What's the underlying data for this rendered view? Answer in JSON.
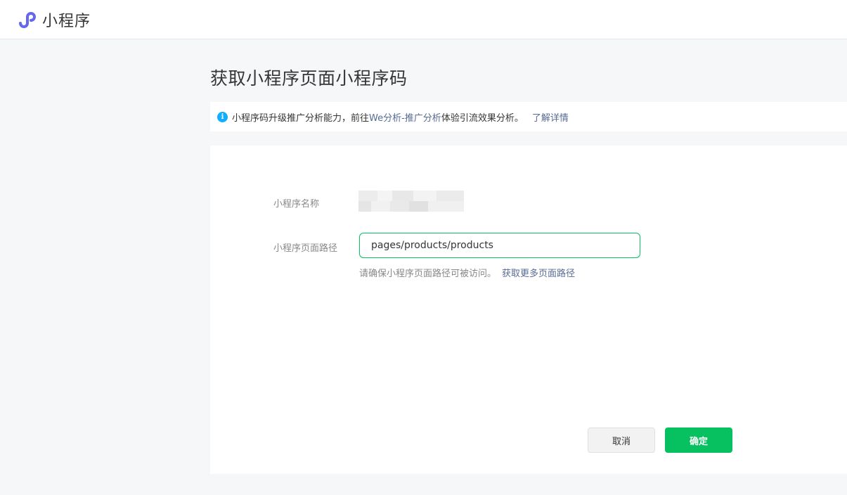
{
  "app": {
    "title": "小程序",
    "logo_icon": "miniprogram-logo-icon",
    "brand_color": "#6467f0"
  },
  "page": {
    "title": "获取小程序页面小程序码"
  },
  "notice": {
    "icon": "info-icon",
    "text_before": "小程序码升级推广分析能力，前往",
    "link_text": "We分析-推广分析",
    "text_after": "体验引流效果分析。",
    "more_link": "了解详情"
  },
  "form": {
    "name_label": "小程序名称",
    "path_label": "小程序页面路径",
    "path_value": "pages/products/products",
    "hint_text": "请确保小程序页面路径可被访问。",
    "hint_link": "获取更多页面路径"
  },
  "actions": {
    "cancel_label": "取消",
    "confirm_label": "确定",
    "confirm_color": "#07c160"
  }
}
